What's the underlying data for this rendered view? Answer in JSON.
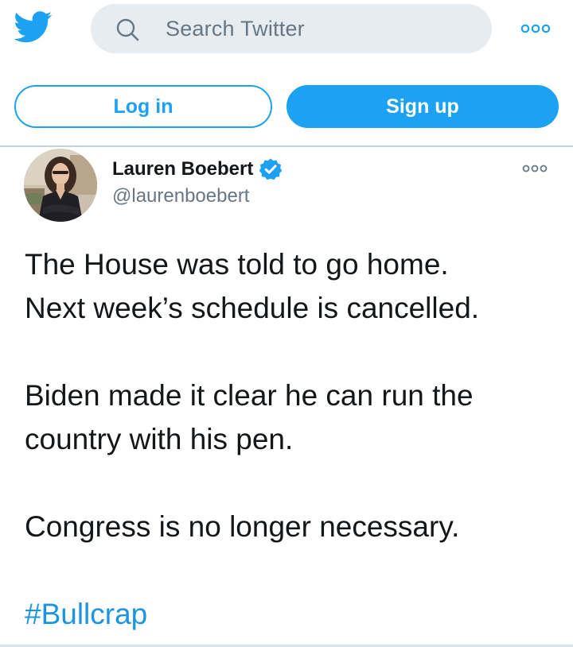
{
  "header": {
    "search_placeholder": "Search Twitter"
  },
  "auth": {
    "login_label": "Log in",
    "signup_label": "Sign up"
  },
  "tweet": {
    "author_name": "Lauren Boebert",
    "author_handle": "@laurenboebert",
    "verified": true,
    "lines": [
      "The House was told to go home.",
      "Next week’s schedule is cancelled.",
      "Biden made it clear he can run the",
      "country with his pen.",
      "Congress is no longer necessary."
    ],
    "hashtag": "#Bullcrap"
  },
  "icons": {
    "logo": "twitter-bird-icon",
    "search": "search-icon",
    "more_top": "more-options-icon",
    "verified": "verified-badge-icon",
    "more_tweet": "more-options-icon"
  },
  "colors": {
    "accent": "#1da1f2",
    "hashtag": "#1b95e0",
    "search_bg": "#e6ecf0",
    "secondary_text": "#657786",
    "primary_text": "#14171a"
  }
}
